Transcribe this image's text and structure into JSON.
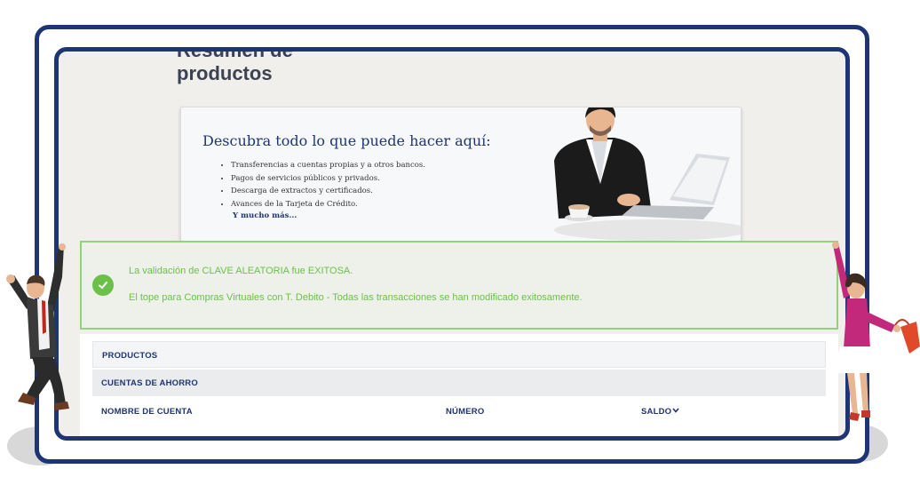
{
  "page": {
    "title_top": "Resumen de",
    "title": "productos"
  },
  "promo": {
    "heading": "Descubra todo lo que puede hacer aquí:",
    "items": [
      "Transferencias a cuentas propias y a otros bancos.",
      "Pagos de servicios públicos y privados.",
      "Descarga de extractos y certificados.",
      "Avances de la Tarjeta de Crédito."
    ],
    "more": "Y mucho más..."
  },
  "alert": {
    "icon": "check-circle-icon",
    "message1": "La validación de CLAVE ALEATORIA fue EXITOSA.",
    "message2": "El tope para Compras Virtuales con T. Debito - Todas las transacciones se han modificado exitosamente."
  },
  "products": {
    "header": "PRODUCTOS",
    "section": "CUENTAS DE AHORRO",
    "columns": {
      "name": "NOMBRE DE CUENTA",
      "number": "NÚMERO",
      "balance": "SALDO"
    },
    "sort_icon": "chevron-down-icon"
  },
  "colors": {
    "frame": "#1f3573",
    "success": "#6cc04a",
    "heading": "#1f3573",
    "background": "#f1efeb"
  }
}
